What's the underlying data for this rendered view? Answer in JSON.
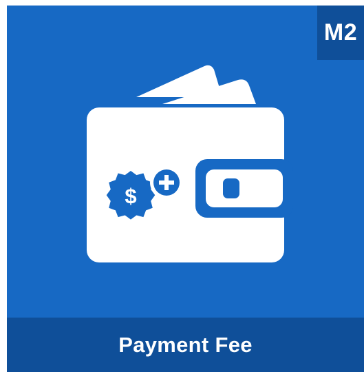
{
  "tile": {
    "badge_text": "M2",
    "footer_title": "Payment Fee",
    "icon": "wallet-payment-fee-icon",
    "badge_icon": "dollar-seal-icon",
    "plus_icon": "plus-icon",
    "colors": {
      "background": "#1769c4",
      "bar": "#0f4f99",
      "foreground": "#ffffff"
    }
  }
}
